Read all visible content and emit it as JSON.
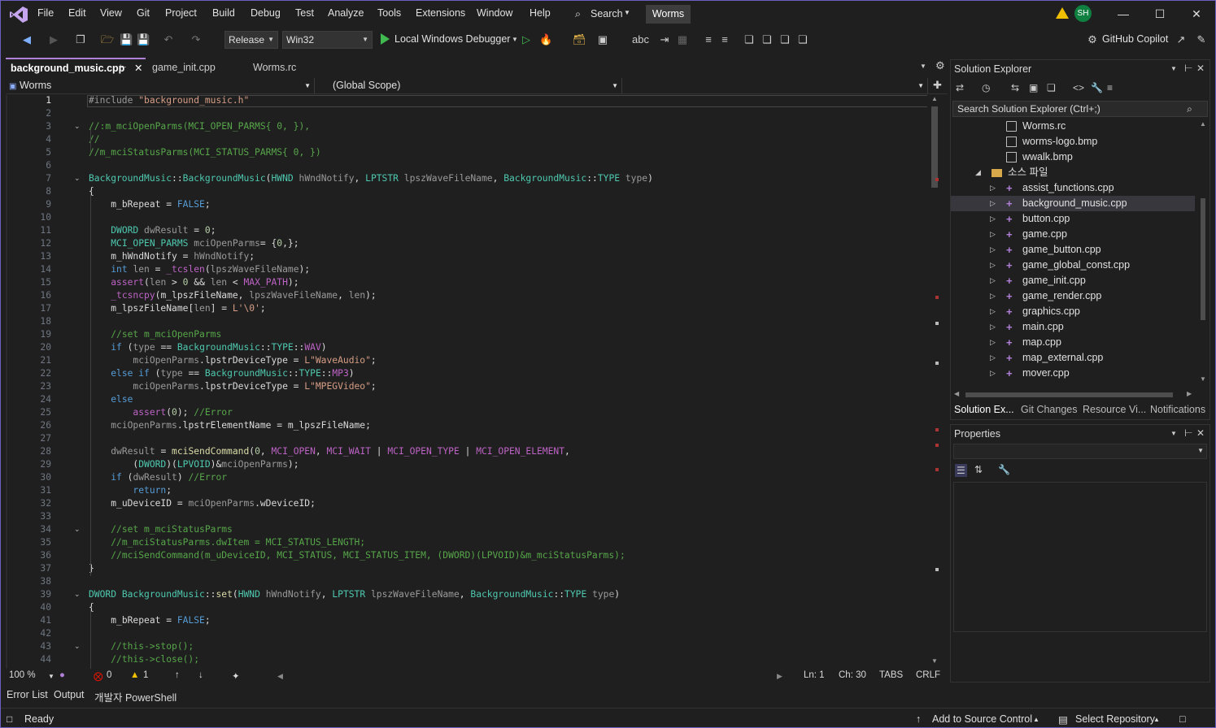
{
  "menu": [
    "File",
    "Edit",
    "View",
    "Git",
    "Project",
    "Build",
    "Debug",
    "Test",
    "Analyze",
    "Tools",
    "Extensions",
    "Window",
    "Help"
  ],
  "search_label": "Search",
  "solution_name": "Worms",
  "avatar_initials": "SH",
  "toolbar": {
    "config": "Release",
    "platform": "Win32",
    "debugger": "Local Windows Debugger",
    "copilot": "GitHub Copilot"
  },
  "tabs": [
    {
      "label": "background_music.cpp",
      "active": true
    },
    {
      "label": "game_init.cpp",
      "active": false
    },
    {
      "label": "Worms.rc",
      "active": false
    }
  ],
  "nav": {
    "project": "Worms",
    "scope": "(Global Scope)"
  },
  "line_numbers": [
    "1",
    "2",
    "3",
    "4",
    "5",
    "6",
    "7",
    "8",
    "9",
    "10",
    "11",
    "12",
    "13",
    "14",
    "15",
    "16",
    "17",
    "18",
    "19",
    "20",
    "21",
    "22",
    "23",
    "24",
    "25",
    "26",
    "27",
    "28",
    "29",
    "30",
    "31",
    "32",
    "33",
    "34",
    "35",
    "36",
    "37",
    "38",
    "39",
    "40",
    "41",
    "42",
    "43",
    "44"
  ],
  "code_lines": [
    "#include \"background_music.h\"",
    "",
    "//:m_mciOpenParms(MCI_OPEN_PARMS{ 0, }),",
    "//",
    "//m_mciStatusParms(MCI_STATUS_PARMS{ 0, })",
    "",
    "BackgroundMusic::BackgroundMusic(HWND hWndNotify, LPTSTR lpszWaveFileName, BackgroundMusic::TYPE type)",
    "{",
    "    m_bRepeat = FALSE;",
    "",
    "    DWORD dwResult = 0;",
    "    MCI_OPEN_PARMS mciOpenParms= {0,};",
    "    m_hWndNotify = hWndNotify;",
    "    int len = _tcslen(lpszWaveFileName);",
    "    assert(len > 0 && len < MAX_PATH);",
    "    _tcsncpy(m_lpszFileName, lpszWaveFileName, len);",
    "    m_lpszFileName[len] = L'\\0';",
    "",
    "    //set m_mciOpenParms",
    "    if (type == BackgroundMusic::TYPE::WAV)",
    "        mciOpenParms.lpstrDeviceType = L\"WaveAudio\";",
    "    else if (type == BackgroundMusic::TYPE::MP3)",
    "        mciOpenParms.lpstrDeviceType = L\"MPEGVideo\";",
    "    else",
    "        assert(0); //Error",
    "    mciOpenParms.lpstrElementName = m_lpszFileName;",
    "",
    "    dwResult = mciSendCommand(0, MCI_OPEN, MCI_WAIT | MCI_OPEN_TYPE | MCI_OPEN_ELEMENT,",
    "        (DWORD)(LPVOID)&mciOpenParms);",
    "    if (dwResult) //Error",
    "        return;",
    "    m_uDeviceID = mciOpenParms.wDeviceID;",
    "",
    "    //set m_mciStatusParms",
    "    //m_mciStatusParms.dwItem = MCI_STATUS_LENGTH;",
    "    //mciSendCommand(m_uDeviceID, MCI_STATUS, MCI_STATUS_ITEM, (DWORD)(LPVOID)&m_mciStatusParms);",
    "}",
    "",
    "DWORD BackgroundMusic::set(HWND hWndNotify, LPTSTR lpszWaveFileName, BackgroundMusic::TYPE type)",
    "{",
    "    m_bRepeat = FALSE;",
    "",
    "    //this->stop();",
    "    //this->close();"
  ],
  "editor_status": {
    "zoom": "100 %",
    "errors": "0",
    "warnings": "1",
    "line": "Ln: 1",
    "char": "Ch: 30",
    "tabs": "TABS",
    "eol": "CRLF"
  },
  "bottom_tabs": [
    "Error List",
    "Output",
    "개발자 PowerShell"
  ],
  "status": {
    "ready": "Ready",
    "source_control": "Add to Source Control",
    "repository": "Select Repository"
  },
  "solution_explorer": {
    "title": "Solution Explorer",
    "search_placeholder": "Search Solution Explorer (Ctrl+;)",
    "items": [
      {
        "label": "Worms.rc",
        "kind": "rc",
        "indent": 2
      },
      {
        "label": "worms-logo.bmp",
        "kind": "bmp",
        "indent": 2
      },
      {
        "label": "wwalk.bmp",
        "kind": "bmp",
        "indent": 2
      },
      {
        "label": "소스 파일",
        "kind": "folder",
        "indent": 1,
        "expanded": true
      },
      {
        "label": "assist_functions.cpp",
        "kind": "cpp",
        "indent": 2
      },
      {
        "label": "background_music.cpp",
        "kind": "cpp",
        "indent": 2,
        "selected": true
      },
      {
        "label": "button.cpp",
        "kind": "cpp",
        "indent": 2
      },
      {
        "label": "game.cpp",
        "kind": "cpp",
        "indent": 2
      },
      {
        "label": "game_button.cpp",
        "kind": "cpp",
        "indent": 2
      },
      {
        "label": "game_global_const.cpp",
        "kind": "cpp",
        "indent": 2
      },
      {
        "label": "game_init.cpp",
        "kind": "cpp",
        "indent": 2
      },
      {
        "label": "game_render.cpp",
        "kind": "cpp",
        "indent": 2
      },
      {
        "label": "graphics.cpp",
        "kind": "cpp",
        "indent": 2
      },
      {
        "label": "main.cpp",
        "kind": "cpp",
        "indent": 2
      },
      {
        "label": "map.cpp",
        "kind": "cpp",
        "indent": 2
      },
      {
        "label": "map_external.cpp",
        "kind": "cpp",
        "indent": 2
      },
      {
        "label": "mover.cpp",
        "kind": "cpp",
        "indent": 2
      }
    ],
    "tabs": [
      "Solution Ex...",
      "Git Changes",
      "Resource Vi...",
      "Notifications"
    ]
  },
  "properties": {
    "title": "Properties"
  },
  "colors": {
    "accent": "#b180d7",
    "background": "#1f1f1f",
    "comment": "#57a64a",
    "keyword": "#569cd6",
    "type": "#4ec9b0"
  }
}
